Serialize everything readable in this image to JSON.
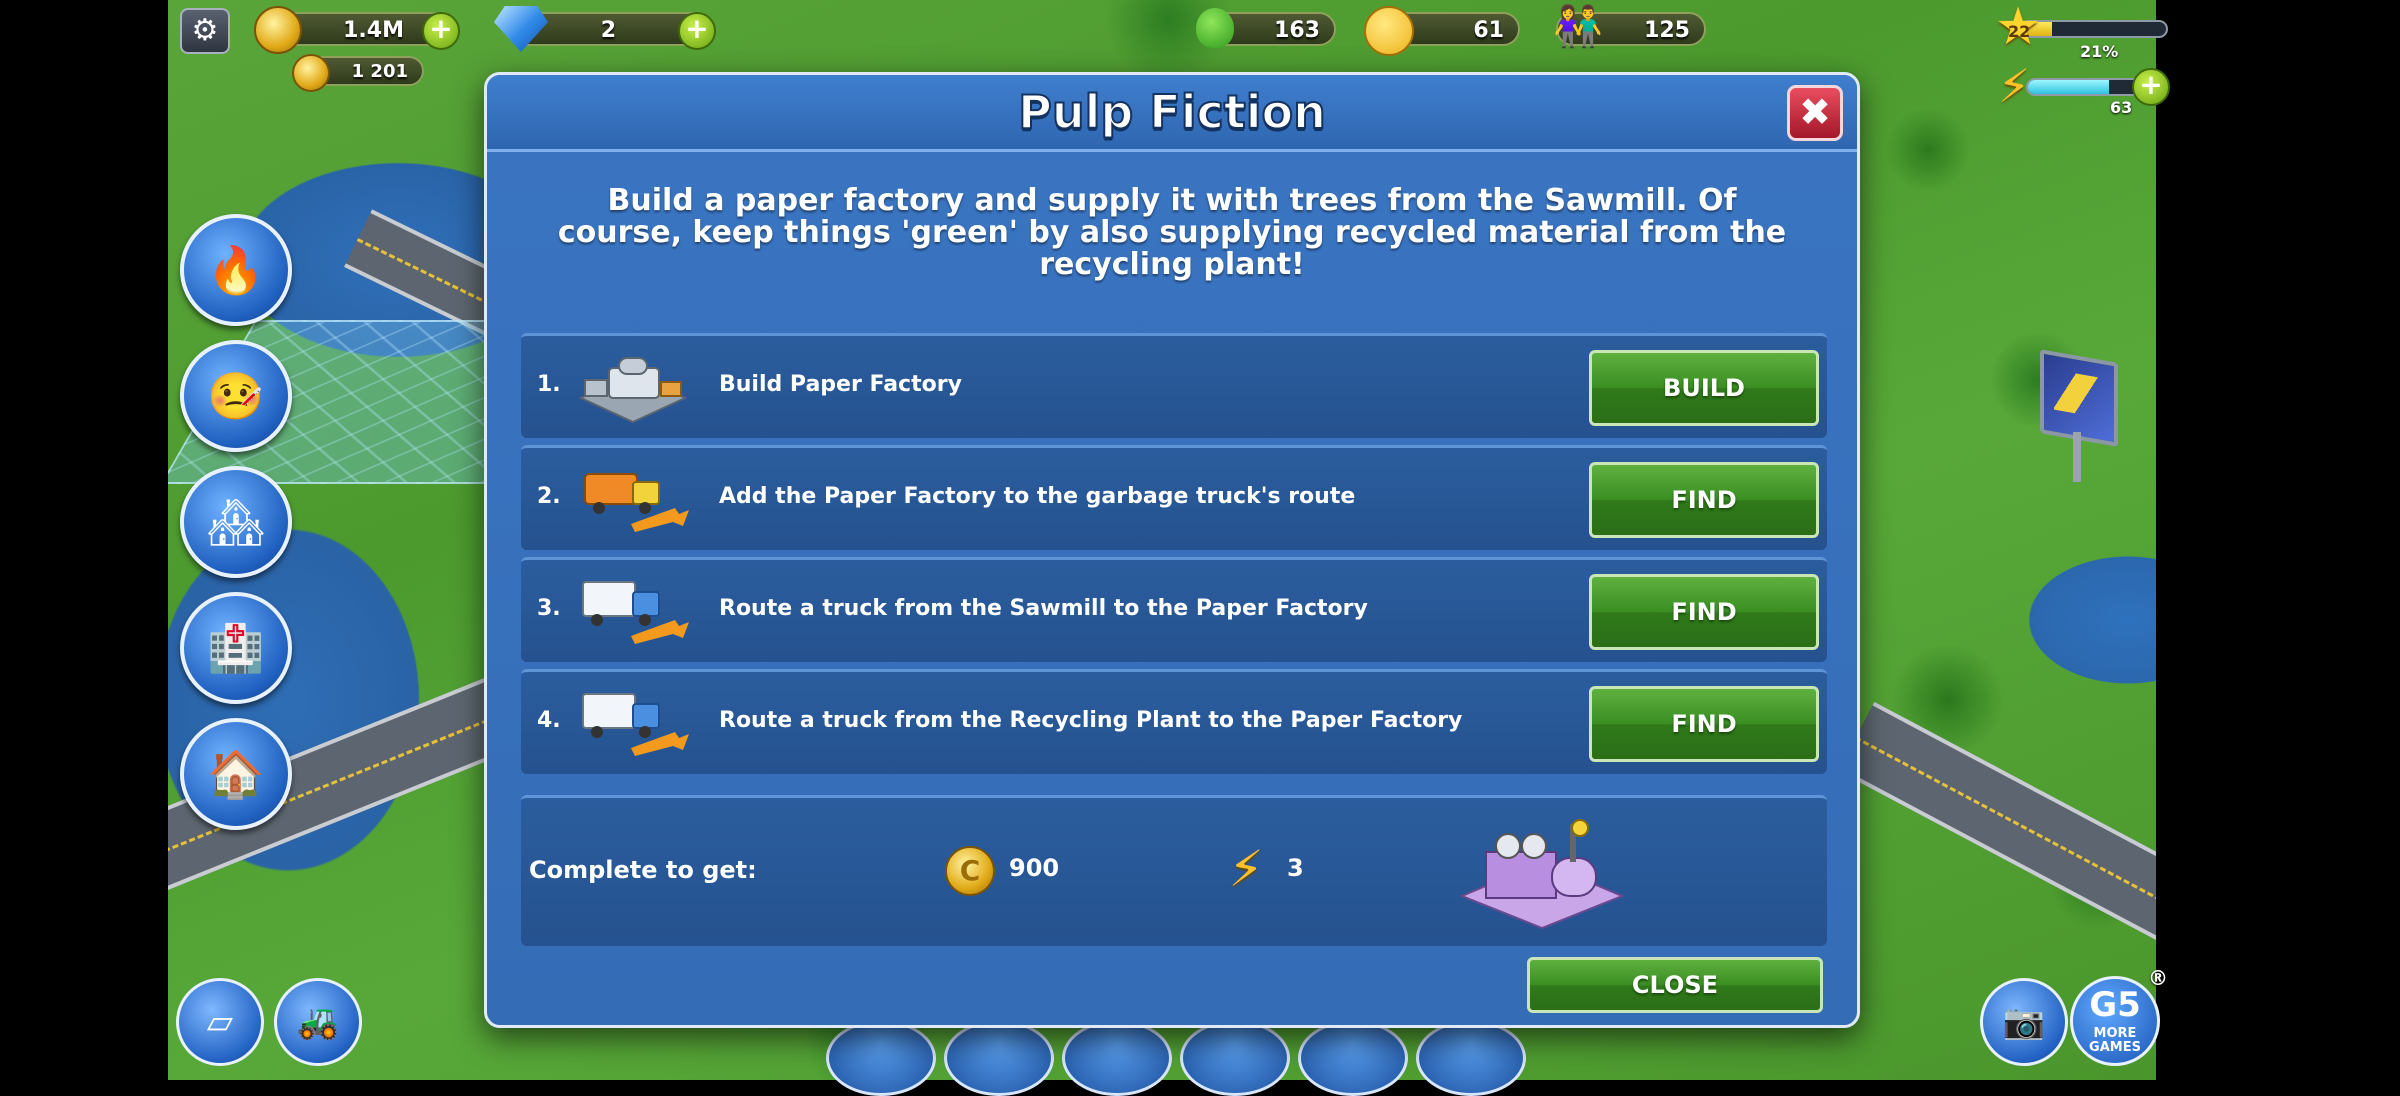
{
  "hud": {
    "coins": "1.4M",
    "gems": "2",
    "secondary_coins": "1 201",
    "trees": "163",
    "happiness": "61",
    "population": "125",
    "level": "22",
    "xp_percent": "21%",
    "xp_progress": 0.21,
    "energy": "63",
    "energy_progress": 0.7,
    "plus": "+",
    "gear_glyph": "⚙"
  },
  "dialog": {
    "title": "Pulp Fiction",
    "close_glyph": "✖",
    "description": "Build a paper factory and supply it with trees from the Sawmill. Of course, keep things 'green' by also supplying recycled material from the recycling plant!",
    "tasks": [
      {
        "num": "1.",
        "label": "Build Paper Factory",
        "button": "BUILD",
        "icon": "paper-factory-icon"
      },
      {
        "num": "2.",
        "label": "Add the Paper Factory to the garbage truck's route",
        "button": "FIND",
        "icon": "garbage-truck-icon"
      },
      {
        "num": "3.",
        "label": "Route a truck from the Sawmill to the Paper Factory",
        "button": "FIND",
        "icon": "truck-icon"
      },
      {
        "num": "4.",
        "label": "Route a truck from the Recycling Plant to the Paper Factory",
        "button": "FIND",
        "icon": "truck-icon"
      }
    ],
    "reward": {
      "label": "Complete to get:",
      "coins": "900",
      "energy": "3",
      "coin_glyph": "C"
    },
    "close_button": "CLOSE"
  },
  "g5": {
    "logo": "G5",
    "text": "MORE GAMES",
    "reg": "®"
  },
  "colors": {
    "dialog_blue": "#3a75c2",
    "row_blue": "#25528f",
    "button_green": "#3a8e22",
    "close_red": "#c0263a"
  }
}
